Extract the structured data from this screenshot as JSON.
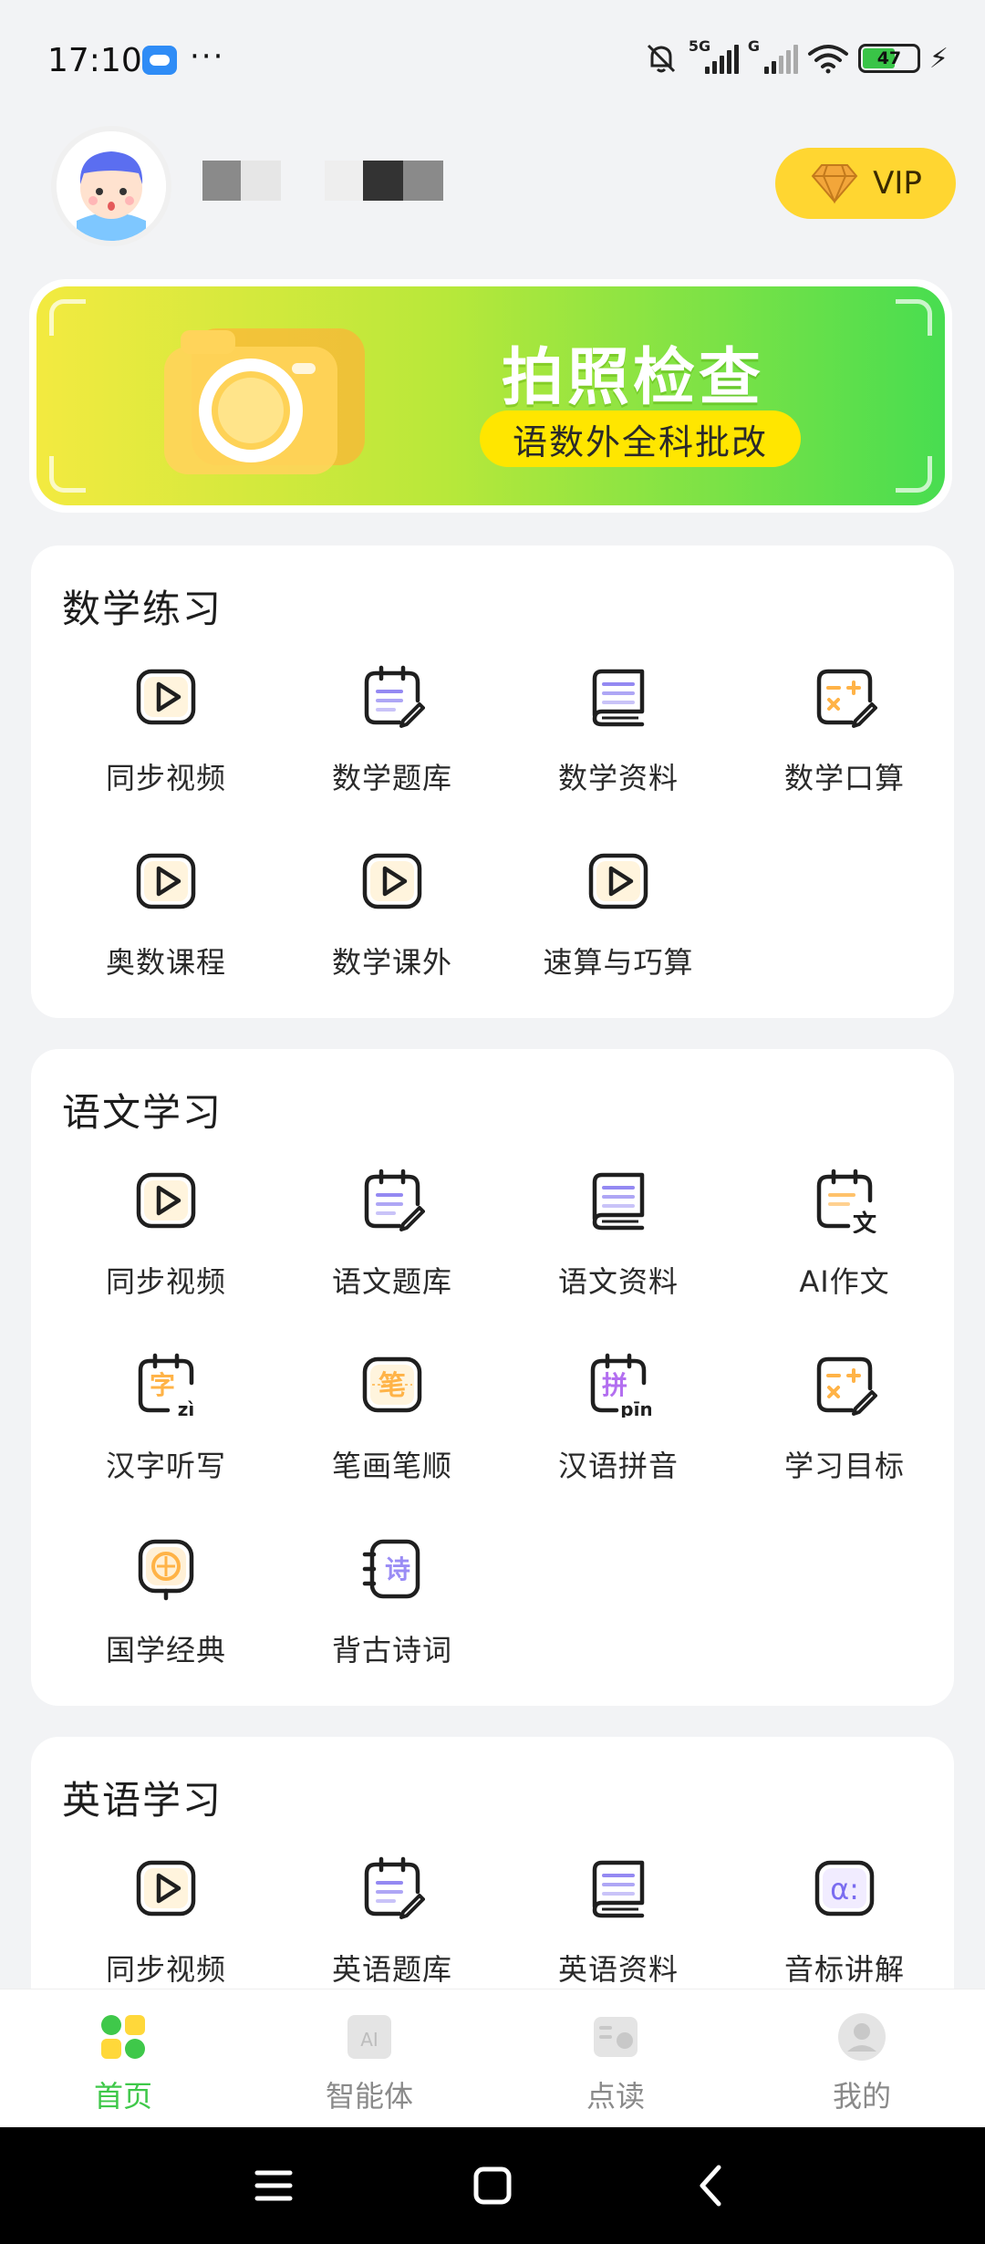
{
  "status_bar": {
    "time": "17:10",
    "more": "···",
    "net1": "5G",
    "net2": "G",
    "battery_level": "47"
  },
  "profile": {
    "vip_label": "VIP"
  },
  "banner": {
    "title": "拍照检查",
    "subtitle": "语数外全科批改"
  },
  "sections": [
    {
      "title": "数学练习",
      "items": [
        {
          "label": "同步视频",
          "icon": "play-icon"
        },
        {
          "label": "数学题库",
          "icon": "notepad-pen-icon"
        },
        {
          "label": "数学资料",
          "icon": "book-icon"
        },
        {
          "label": "数学口算",
          "icon": "calc-pen-icon"
        },
        {
          "label": "奥数课程",
          "icon": "play-icon"
        },
        {
          "label": "数学课外",
          "icon": "play-icon"
        },
        {
          "label": "速算与巧算",
          "icon": "play-icon"
        }
      ]
    },
    {
      "title": "语文学习",
      "items": [
        {
          "label": "同步视频",
          "icon": "play-icon"
        },
        {
          "label": "语文题库",
          "icon": "notepad-pen-icon"
        },
        {
          "label": "语文资料",
          "icon": "book-icon"
        },
        {
          "label": "AI作文",
          "icon": "notepad-wen-icon"
        },
        {
          "label": "汉字听写",
          "icon": "zi-icon"
        },
        {
          "label": "笔画笔顺",
          "icon": "bi-icon"
        },
        {
          "label": "汉语拼音",
          "icon": "pinyin-icon"
        },
        {
          "label": "学习目标",
          "icon": "calc-pen-icon"
        },
        {
          "label": "国学经典",
          "icon": "lantern-icon"
        },
        {
          "label": "背古诗词",
          "icon": "poem-icon"
        }
      ]
    },
    {
      "title": "英语学习",
      "items": [
        {
          "label": "同步视频",
          "icon": "play-icon"
        },
        {
          "label": "英语题库",
          "icon": "notepad-pen-icon"
        },
        {
          "label": "英语资料",
          "icon": "book-icon"
        },
        {
          "label": "音标讲解",
          "icon": "alpha-icon"
        }
      ]
    }
  ],
  "icon_glyphs": {
    "zi": "字",
    "zi_pinyin": "zì",
    "bi": "笔",
    "pin": "拼",
    "pin_pinyin": "pīn",
    "wen": "文",
    "shi": "诗",
    "alpha": "α:"
  },
  "tabbar": {
    "tabs": [
      {
        "label": "首页",
        "active": true
      },
      {
        "label": "智能体",
        "active": false
      },
      {
        "label": "点读",
        "active": false
      },
      {
        "label": "我的",
        "active": false
      }
    ],
    "ai_glyph": "AI"
  },
  "colors": {
    "accent_green": "#3fc84a",
    "vip_yellow": "#ffd631",
    "icon_orange": "#ffb347",
    "icon_purple": "#7a6cf0"
  }
}
